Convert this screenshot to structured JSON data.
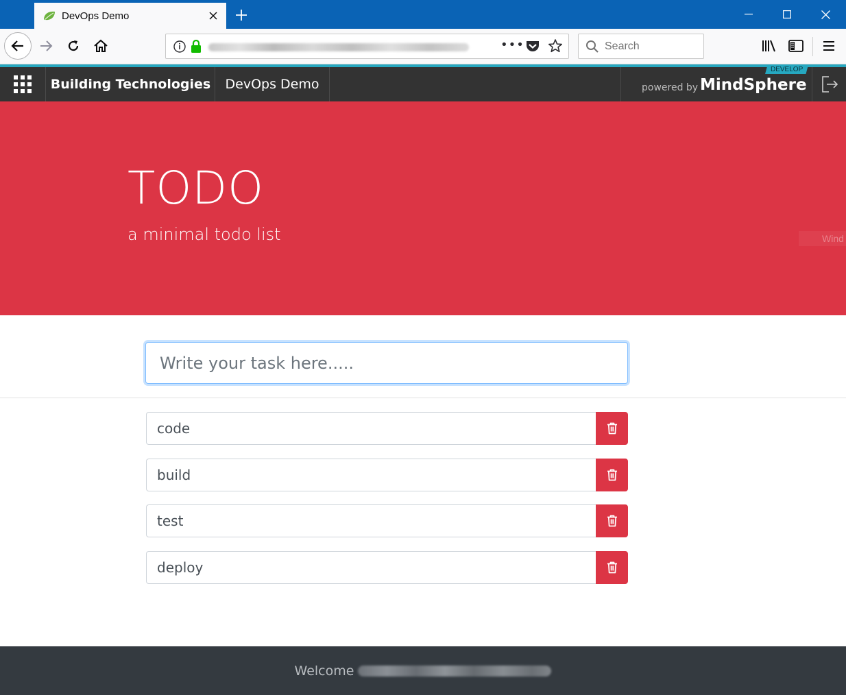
{
  "browser": {
    "tab_title": "DevOps Demo",
    "search_placeholder": "Search"
  },
  "appbar": {
    "items": [
      "Building Technologies",
      "DevOps Demo"
    ],
    "powered_by": "powered by",
    "brand": "MindSphere",
    "badge": "DEVELOP"
  },
  "hero": {
    "title": "TODO",
    "subtitle": "a minimal todo list",
    "watermark": "Wind"
  },
  "main": {
    "input_placeholder": "Write your task here.....",
    "todos": [
      {
        "label": "code"
      },
      {
        "label": "build"
      },
      {
        "label": "test"
      },
      {
        "label": "deploy"
      }
    ]
  },
  "footer": {
    "welcome": "Welcome"
  },
  "colors": {
    "titlebar": "#0a63b5",
    "accent": "#26a8c0",
    "appbar": "#333333",
    "hero": "#dc3545",
    "footer": "#343a40"
  },
  "icons": {
    "favicon": "spring-leaf-icon",
    "delete": "trash-icon",
    "launcher": "grid-icon",
    "logout": "logout-icon"
  }
}
